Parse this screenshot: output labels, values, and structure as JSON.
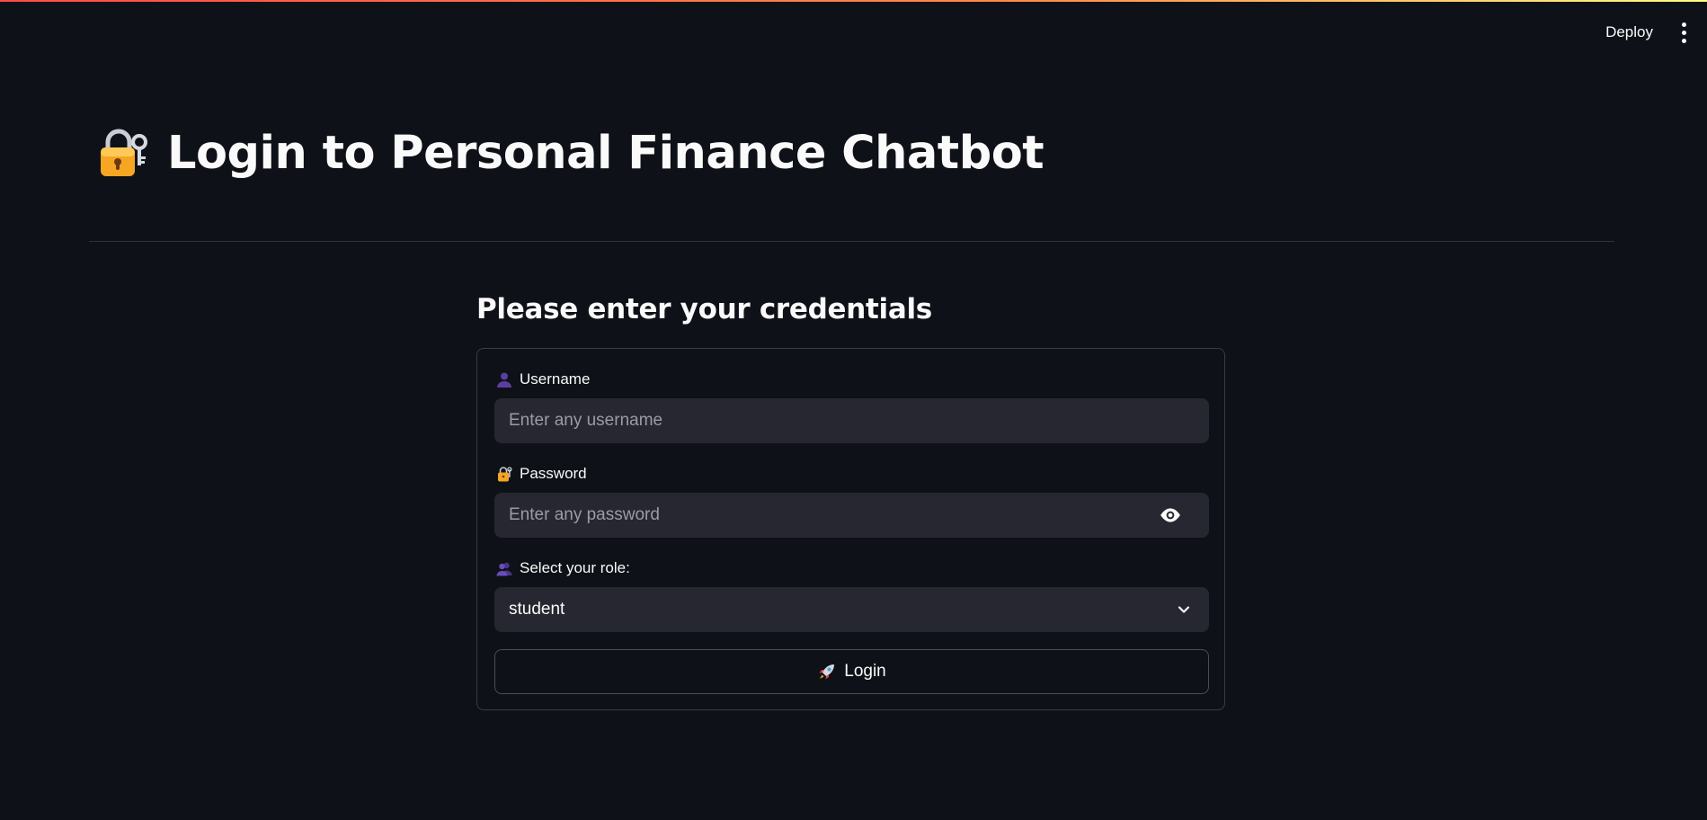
{
  "header": {
    "deploy_label": "Deploy",
    "menu_icon": "kebab-menu-icon"
  },
  "page": {
    "title_icon": "locked-with-key-icon",
    "title": "Login to Personal Finance Chatbot",
    "subheading": "Please enter your credentials"
  },
  "form": {
    "username": {
      "icon": "user-silhouette-icon",
      "label": "Username",
      "placeholder": "Enter any username",
      "value": ""
    },
    "password": {
      "icon": "locked-with-key-icon",
      "label": "Password",
      "placeholder": "Enter any password",
      "value": "",
      "toggle_icon": "eye-icon"
    },
    "role": {
      "icon": "users-silhouette-icon",
      "label": "Select your role:",
      "selected": "student",
      "dropdown_icon": "chevron-down-icon"
    },
    "submit": {
      "icon": "rocket-icon",
      "label": "Login"
    }
  },
  "colors": {
    "background": "#0e1117",
    "input_background": "#262730",
    "border": "#3a3d47",
    "text": "#fafafa",
    "placeholder": "#9a9ca5",
    "accent": "#ff4b4b"
  }
}
